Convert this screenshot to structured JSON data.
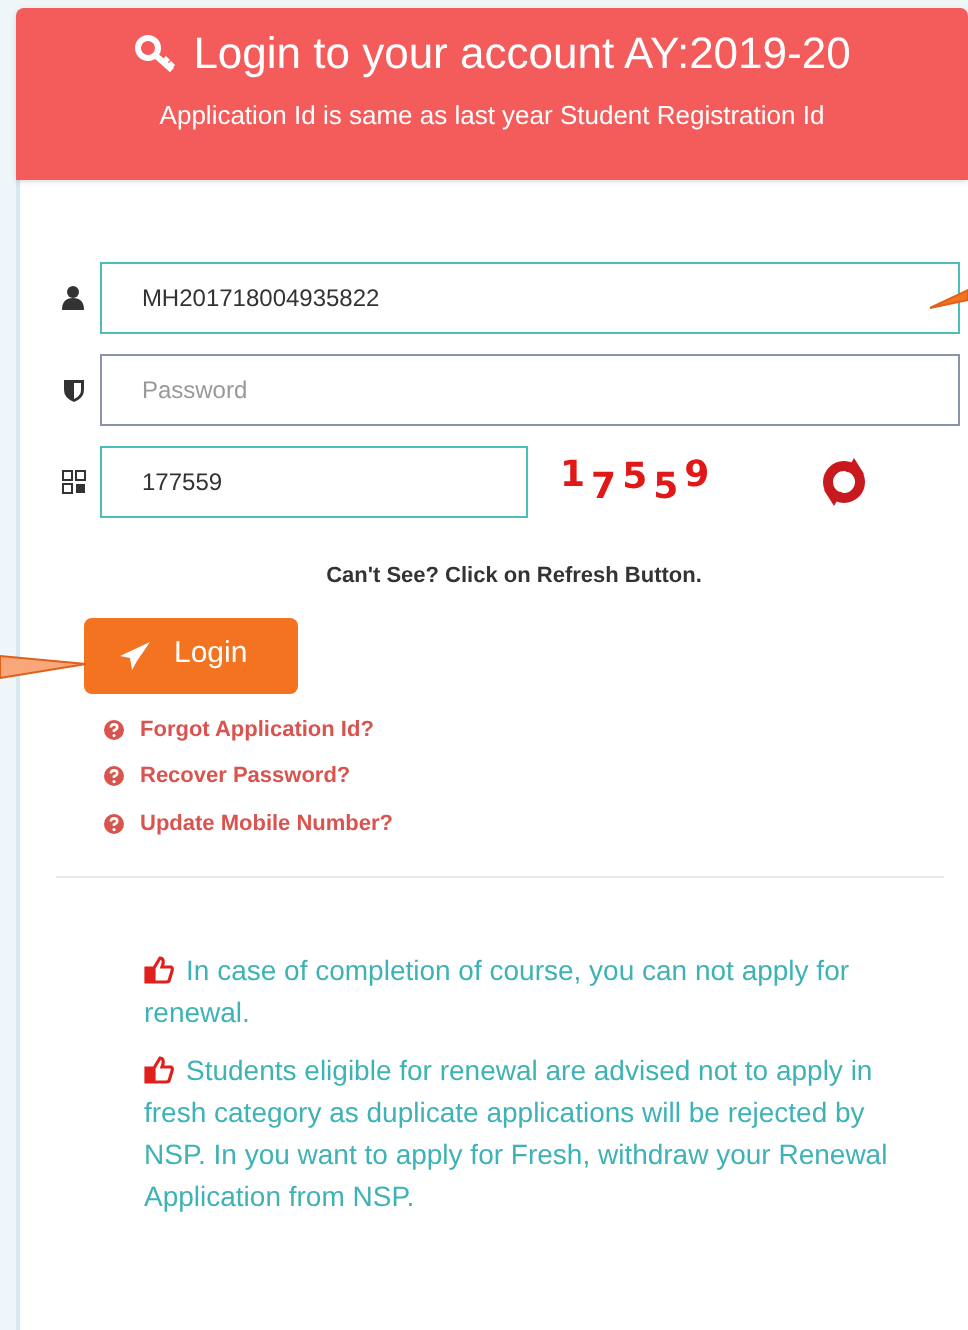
{
  "header": {
    "title": "Login to your account AY:2019-20",
    "subtitle": "Application Id is same as last year Student Registration Id"
  },
  "fields": [
    {
      "kind": "user",
      "value": "MH201718004935822",
      "focused": true
    },
    {
      "kind": "password",
      "placeholder": "Password",
      "focused": false
    },
    {
      "kind": "captcha",
      "value": "177559",
      "focused": true
    }
  ],
  "captcha_text": "17559",
  "captcha_hint": "Can't See? Click on Refresh Button.",
  "login_button": "Login",
  "links": [
    "Forgot Application Id?",
    "Recover Password?",
    "Update Mobile Number?"
  ],
  "notes": [
    "In case of completion of course, you can not apply for renewal.",
    "Students eligible for renewal are advised not to apply in fresh category as duplicate applications will be rejected by NSP. In you want to apply for Fresh, withdraw your Renewal Application from NSP."
  ]
}
